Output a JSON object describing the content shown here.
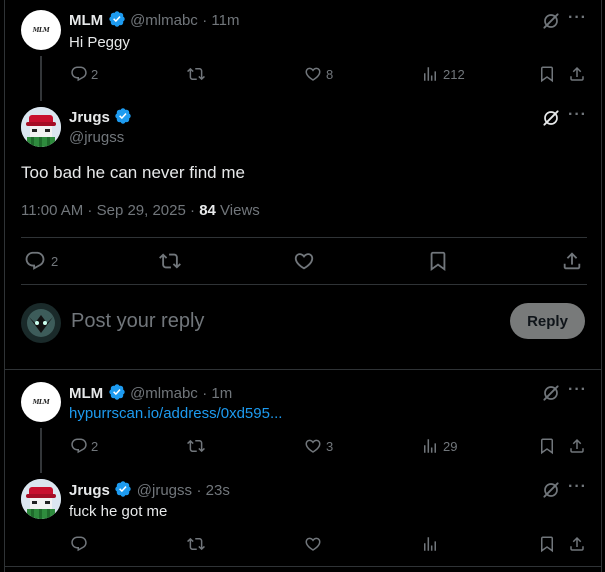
{
  "colors": {
    "background": "#000000",
    "text": "#e7e9ea",
    "muted": "#71767b",
    "link": "#1d9bf0",
    "verified": "#1d9bf0",
    "border": "#2f3336"
  },
  "tweet1": {
    "avatar_text": "MLM",
    "name": "MLM",
    "handle": "@mlmabc",
    "time": "· 11m",
    "text": "Hi Peggy",
    "replies": "2",
    "likes": "8",
    "views": "212"
  },
  "main_tweet": {
    "name": "Jrugs",
    "handle": "@jrugss",
    "text": "Too bad he can never find me",
    "timestamp": "11:00 AM · Sep 29, 2025 ·",
    "views_count": "84",
    "views_label": "Views",
    "replies": "2"
  },
  "composer": {
    "placeholder": "Post your reply",
    "button_label": "Reply"
  },
  "tweet3": {
    "avatar_text": "MLM",
    "name": "MLM",
    "handle": "@mlmabc",
    "time": "· 1m",
    "link_text": "hypurrscan.io/address/0xd595...",
    "replies": "2",
    "likes": "3",
    "views": "29"
  },
  "tweet4": {
    "name": "Jrugs",
    "handle": "@jrugss",
    "time": "· 23s",
    "text": "fuck he got me"
  },
  "icons": [
    "reply-icon",
    "repost-icon",
    "like-icon",
    "views-icon",
    "bookmark-icon",
    "share-icon",
    "grok-icon",
    "more-icon",
    "verified-icon"
  ]
}
